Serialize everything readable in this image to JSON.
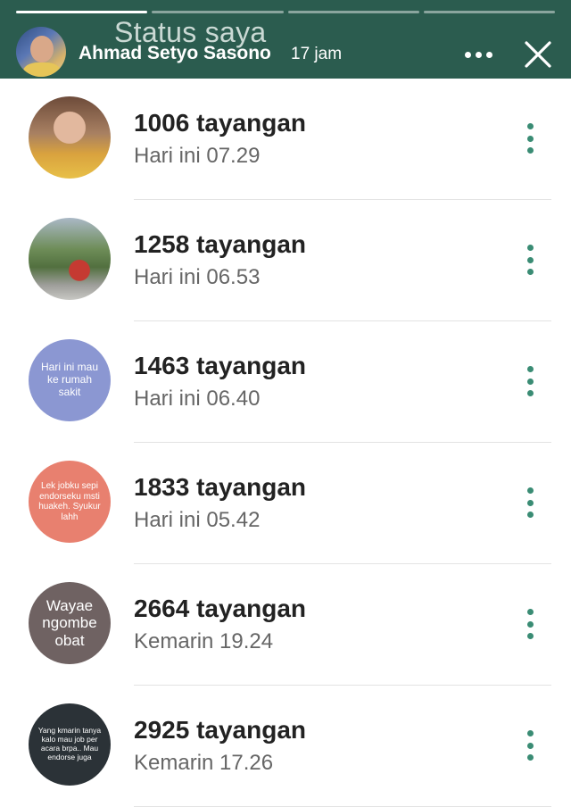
{
  "header": {
    "title": "Status saya",
    "poster_name": "Ahmad Setyo Sasono",
    "time_ago": "17 jam",
    "progress_segments": 4,
    "active_segment": 1,
    "background": "#2b5c4f"
  },
  "icons": {
    "more": "more-horizontal-icon",
    "close": "close-icon",
    "kebab": "more-vertical-icon"
  },
  "accent_color": "#3a8c74",
  "statuses": [
    {
      "views": "1006 tayangan",
      "time": "Hari ini 07.29",
      "thumb_type": "photo",
      "thumb_text": ""
    },
    {
      "views": "1258 tayangan",
      "time": "Hari ini 06.53",
      "thumb_type": "photo",
      "thumb_text": ""
    },
    {
      "views": "1463 tayangan",
      "time": "Hari ini 06.40",
      "thumb_type": "text",
      "thumb_color": "#8b97d2",
      "thumb_text": "Hari ini mau ke rumah sakit"
    },
    {
      "views": "1833 tayangan",
      "time": "Hari ini 05.42",
      "thumb_type": "text",
      "thumb_color": "#e8806f",
      "thumb_text": "Lek jobku sepi endorseku msti huakeh. Syukur lahh"
    },
    {
      "views": "2664 tayangan",
      "time": "Kemarin 19.24",
      "thumb_type": "text",
      "thumb_color": "#6f6262",
      "thumb_text": "Wayae ngombe obat"
    },
    {
      "views": "2925 tayangan",
      "time": "Kemarin 17.26",
      "thumb_type": "text",
      "thumb_color": "#2b3237",
      "thumb_text": "Yang kmarin tanya kalo mau job per acara brpa.. Mau endorse juga"
    }
  ]
}
